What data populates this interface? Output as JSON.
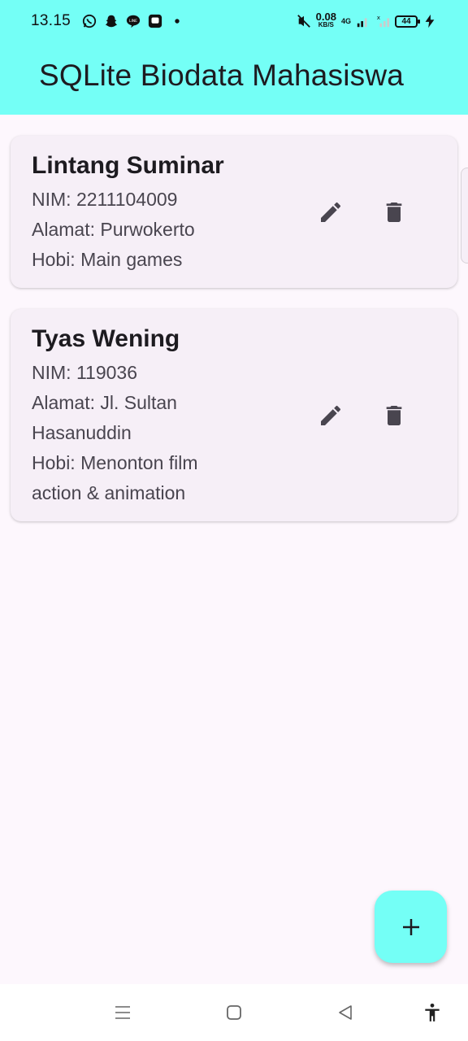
{
  "status_bar": {
    "time": "13.15",
    "speed_value": "0.08",
    "speed_unit": "KB/S",
    "network": "4G",
    "battery": "44"
  },
  "app_bar": {
    "title": "SQLite Biodata Mahasiswa",
    "color": "#74fff6"
  },
  "students": [
    {
      "name": "Lintang Suminar",
      "nim": "NIM: 2211104009",
      "alamat": "Alamat: Purwokerto",
      "hobi": "Hobi: Main games"
    },
    {
      "name": "Tyas Wening",
      "nim": "NIM: 119036",
      "alamat": "Alamat: Jl. Sultan Hasanuddin",
      "hobi": "Hobi: Menonton film action & animation"
    }
  ],
  "icons": {
    "edit": "edit-icon",
    "delete": "delete-icon",
    "add": "add-icon"
  },
  "colors": {
    "background": "#fdf7fd",
    "card": "#f6eff7",
    "icon": "#49454f"
  }
}
